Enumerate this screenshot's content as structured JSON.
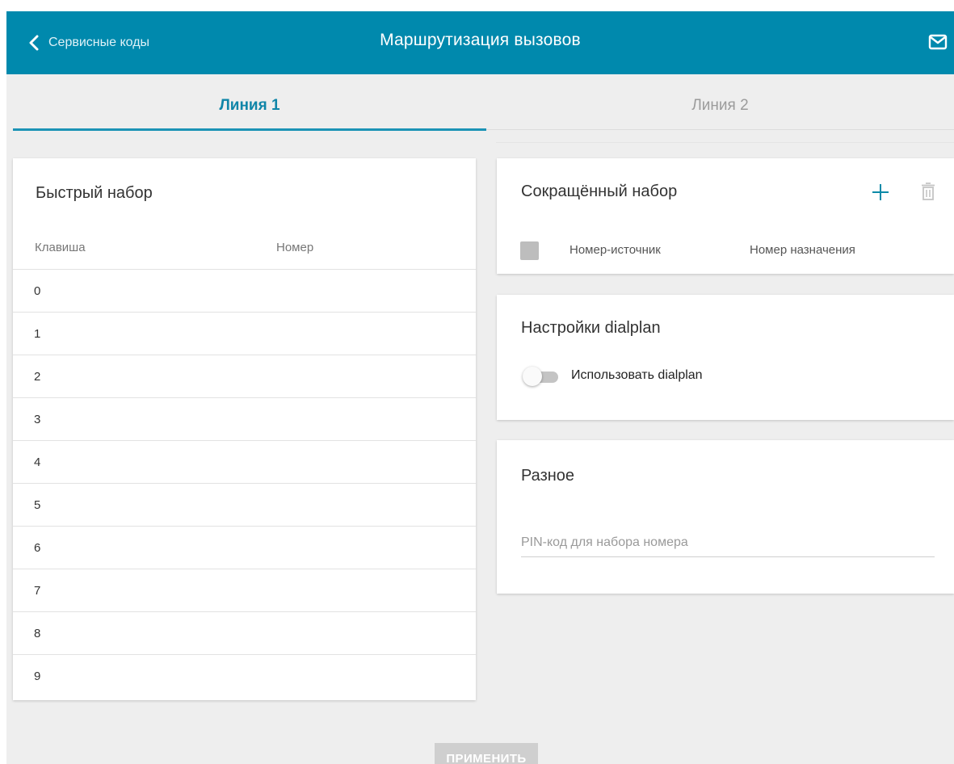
{
  "header": {
    "back_label": "Сервисные коды",
    "title": "Маршрутизация вызовов",
    "back_icon": "chevron-left-icon",
    "mail_icon": "mail-icon",
    "color": "#0089ad"
  },
  "tabs": [
    {
      "label": "Линия 1",
      "active": true
    },
    {
      "label": "Линия 2",
      "active": false
    }
  ],
  "quick_dial": {
    "title": "Быстрый набор",
    "columns": [
      "Клавиша",
      "Номер"
    ],
    "rows": [
      {
        "key": "0",
        "number": ""
      },
      {
        "key": "1",
        "number": ""
      },
      {
        "key": "2",
        "number": ""
      },
      {
        "key": "3",
        "number": ""
      },
      {
        "key": "4",
        "number": ""
      },
      {
        "key": "5",
        "number": ""
      },
      {
        "key": "6",
        "number": ""
      },
      {
        "key": "7",
        "number": ""
      },
      {
        "key": "8",
        "number": ""
      },
      {
        "key": "9",
        "number": ""
      }
    ]
  },
  "speed_dial": {
    "title": "Сокращённый набор",
    "columns": [
      "Номер-источник",
      "Номер назначения"
    ],
    "add_icon": "plus-icon",
    "delete_icon": "trash-icon"
  },
  "dialplan": {
    "title": "Настройки dialplan",
    "toggle_label": "Использовать dialplan",
    "enabled": false
  },
  "misc": {
    "title": "Разное",
    "pin_placeholder": "PIN-код для набора номера",
    "pin_value": ""
  },
  "apply_label": "ПРИМЕНИТЬ"
}
